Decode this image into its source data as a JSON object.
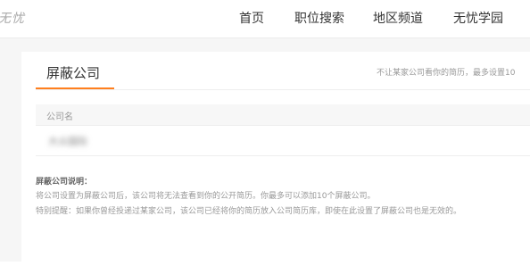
{
  "header": {
    "logo_text": "无忧",
    "nav": [
      {
        "label": "首页"
      },
      {
        "label": "职位搜索"
      },
      {
        "label": "地区频道"
      },
      {
        "label": "无忧学园"
      }
    ]
  },
  "main": {
    "tab_title": "屏蔽公司",
    "tab_hint": "不让某家公司看你的简历，最多设置10",
    "table": {
      "column_header": "公司名",
      "rows": [
        {
          "company_name": "大众国际"
        }
      ]
    },
    "notes": {
      "title": "屏蔽公司说明：",
      "line1": "将公司设置为屏蔽公司后，该公司将无法查看到你的公开简历。你最多可以添加10个屏蔽公司。",
      "line2": "特别提醒：如果你曾经投递过某家公司，该公司已经将你的简历放入公司简历库，即使在此设置了屏蔽公司也是无效的。"
    }
  },
  "colors": {
    "accent": "#ff7f1e",
    "page_background": "#f6f6f6"
  }
}
